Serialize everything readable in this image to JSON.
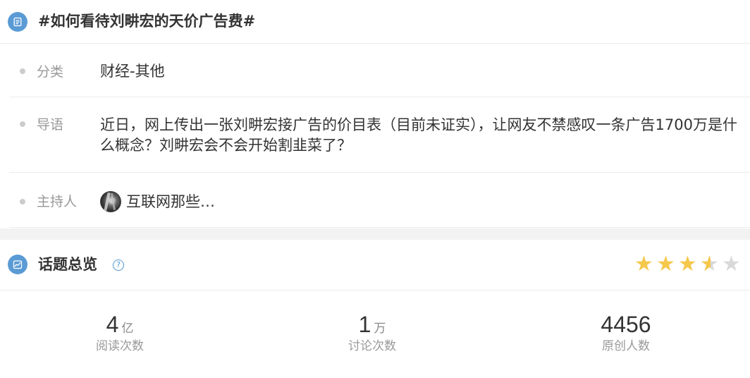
{
  "topic": {
    "title": "#如何看待刘畊宏的天价广告费#",
    "category_label": "分类",
    "category_value": "财经-其他",
    "intro_label": "导语",
    "intro_value": "近日，网上传出一张刘畊宏接广告的价目表（目前未证实），让网友不禁感叹一条广告1700万是什么概念？刘畊宏会不会开始割韭菜了？",
    "host_label": "主持人",
    "host_name": "互联网那些…"
  },
  "overview": {
    "title": "话题总览",
    "help_icon": "?",
    "rating": 3.5,
    "stats": [
      {
        "value": "4",
        "unit": "亿",
        "label": "阅读次数"
      },
      {
        "value": "1",
        "unit": "万",
        "label": "讨论次数"
      },
      {
        "value": "4456",
        "unit": "",
        "label": "原创人数"
      }
    ]
  },
  "icons": {
    "topic": "document-list-icon",
    "overview": "trend-chart-icon",
    "help": "question-icon",
    "avatar": "host-avatar"
  },
  "colors": {
    "accent": "#5b9bd5",
    "star": "#f5c84c",
    "muted": "#999999"
  }
}
